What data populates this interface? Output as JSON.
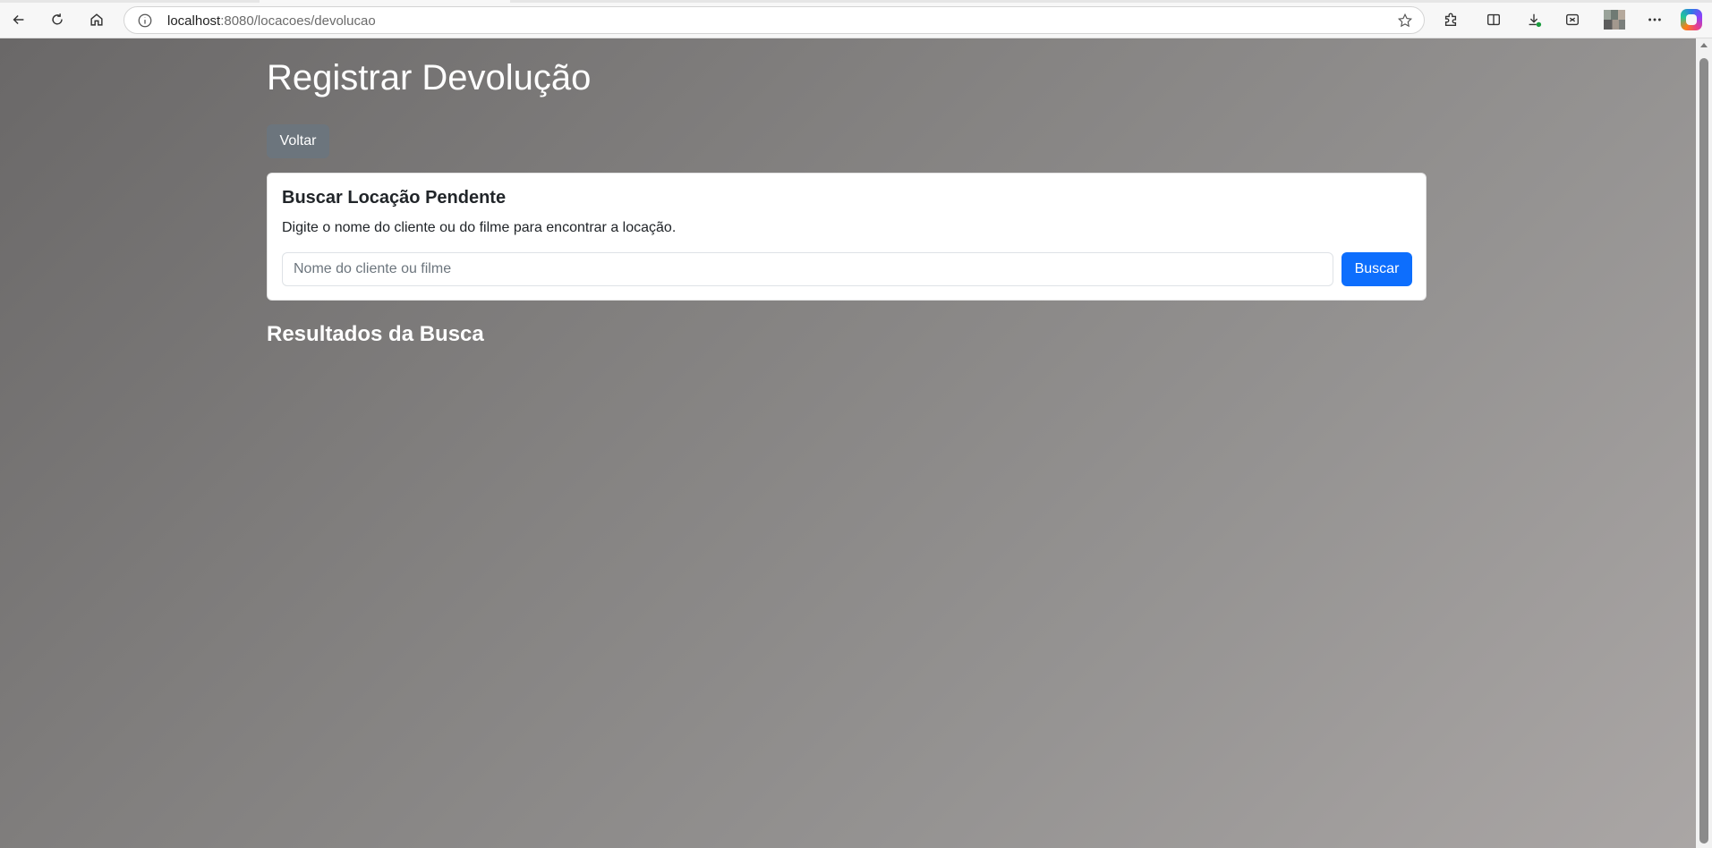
{
  "browser": {
    "url_host": "localhost",
    "url_path": ":8080/locacoes/devolucao",
    "icons": {
      "back": "back-arrow-icon",
      "reload": "reload-icon",
      "home": "home-icon",
      "info": "info-icon",
      "favorite": "star-icon",
      "extensions": "puzzle-icon",
      "split_screen": "split-screen-icon",
      "downloads": "download-icon",
      "browser_essentials": "heart-shield-icon",
      "more": "more-icon",
      "copilot": "copilot-icon"
    }
  },
  "page": {
    "title": "Registrar Devolução",
    "back_button": "Voltar",
    "search_card": {
      "title": "Buscar Locação Pendente",
      "description": "Digite o nome do cliente ou do filme para encontrar a locação.",
      "input_placeholder": "Nome do cliente ou filme",
      "input_value": "",
      "button_label": "Buscar"
    },
    "results_title": "Resultados da Busca",
    "results": []
  },
  "colors": {
    "primary": "#0d6efd",
    "secondary": "#6c757d",
    "background_start": "#6a6868",
    "background_end": "#aaa6a5"
  }
}
